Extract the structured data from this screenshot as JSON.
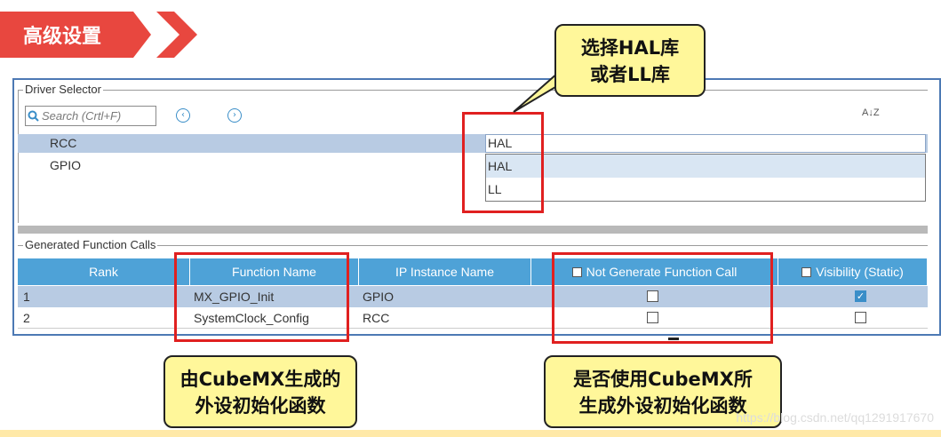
{
  "header": {
    "title": "高级设置"
  },
  "driver_selector": {
    "legend": "Driver Selector",
    "search_placeholder": "Search (Crtl+F)",
    "sort_icon_label": "A↓Z",
    "rows": [
      {
        "name": "RCC",
        "selected": true
      },
      {
        "name": "GPIO",
        "selected": false
      }
    ],
    "selected_value": "HAL",
    "dropdown_options": [
      "HAL",
      "LL"
    ]
  },
  "generated_calls": {
    "legend": "Generated Function Calls",
    "columns": [
      "Rank",
      "Function Name",
      "IP Instance Name",
      "Not Generate Function Call",
      "Visibility (Static)"
    ],
    "rows": [
      {
        "rank": "1",
        "function": "MX_GPIO_Init",
        "ip": "GPIO",
        "not_generate": false,
        "visibility": true
      },
      {
        "rank": "2",
        "function": "SystemClock_Config",
        "ip": "RCC",
        "not_generate": false,
        "visibility": false
      }
    ]
  },
  "callouts": {
    "driver": "选择HAL库\n或者LL库",
    "function_name": "由CubeMX生成的\n外设初始化函数",
    "not_generate": "是否使用CubeMX所\n生成外设初始化函数"
  },
  "watermark": "https://blog.csdn.net/qq1291917670",
  "colors": {
    "ribbon": "#e8473f",
    "table_header": "#4ea2d7",
    "selected_row": "#b8cbe3",
    "highlight_box": "#e02020",
    "callout_bg": "#fff79a"
  }
}
